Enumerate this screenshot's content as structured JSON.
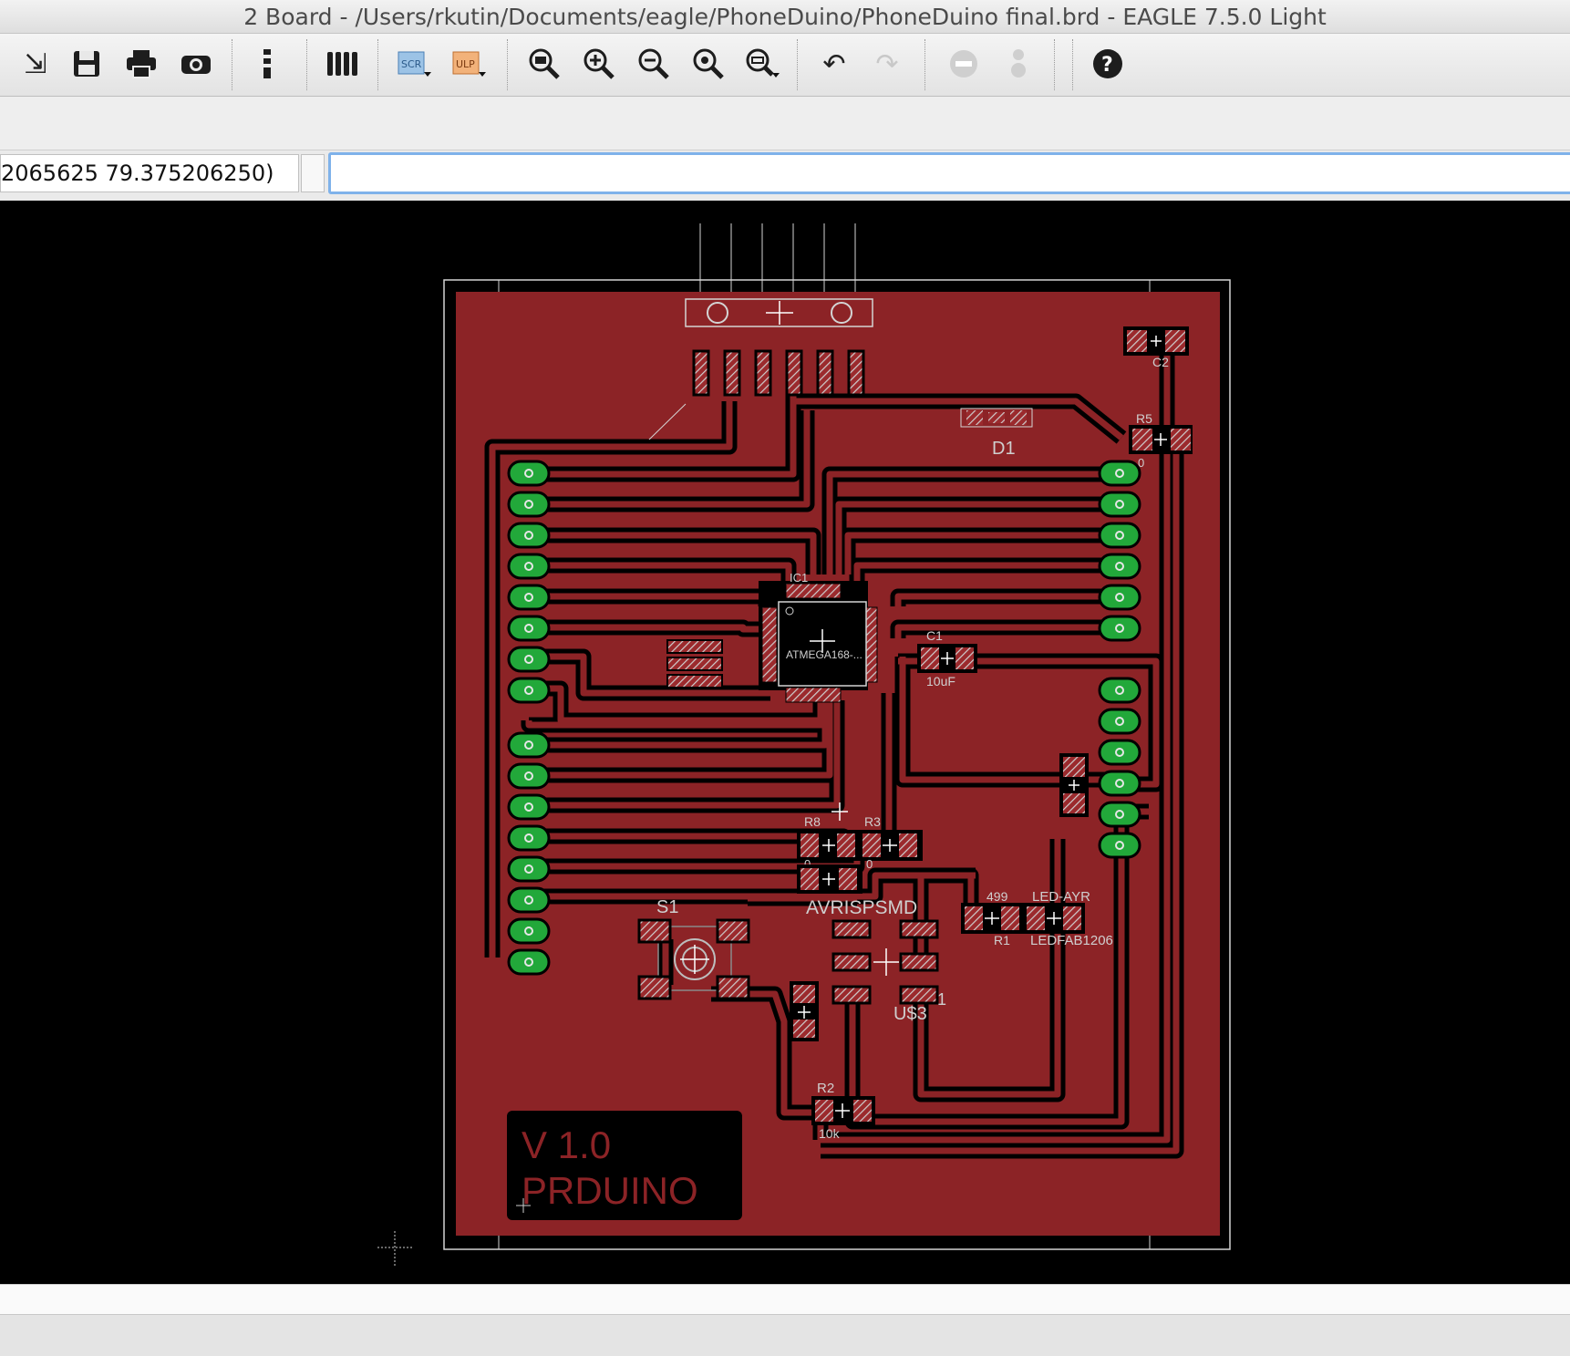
{
  "window": {
    "title": "2 Board - /Users/rkutin/Documents/eagle/PhoneDuino/PhoneDuino final.brd - EAGLE 7.5.0 Light"
  },
  "toolbar": {
    "buttons": [
      {
        "id": "open",
        "glyph": "⇲"
      },
      {
        "id": "save",
        "glyph": "💾"
      },
      {
        "id": "print",
        "glyph": "⎙"
      },
      {
        "id": "cam",
        "glyph": "◙"
      },
      {
        "id": "board",
        "glyph": "⋮"
      },
      {
        "id": "layers",
        "glyph": "▥"
      },
      {
        "id": "script",
        "label": "SCR"
      },
      {
        "id": "ulp",
        "label": "ULP"
      },
      {
        "id": "zoom-fit",
        "glyph": "⊡"
      },
      {
        "id": "zoom-in",
        "glyph": "⊕"
      },
      {
        "id": "zoom-out",
        "glyph": "⊖"
      },
      {
        "id": "zoom-select",
        "glyph": "⊙"
      },
      {
        "id": "zoom-redraw",
        "glyph": "⊜"
      },
      {
        "id": "undo",
        "glyph": "↶"
      },
      {
        "id": "redo",
        "glyph": "↷"
      },
      {
        "id": "stop",
        "glyph": "⊖"
      },
      {
        "id": "go",
        "glyph": "●"
      },
      {
        "id": "help",
        "glyph": "?"
      }
    ]
  },
  "command_bar": {
    "coordinates": "2065625 79.375206250)",
    "command_value": ""
  },
  "board": {
    "silkscreen_text": [
      "V 1.0",
      "PRDUINO"
    ],
    "part_labels": {
      "c2": "C2",
      "r5": "R5",
      "r5_value": "0",
      "d1": "D1",
      "ic1": "IC1",
      "ic1_value": "ATMEGA168-...",
      "c1": "C1",
      "c1_value": "10uF",
      "r8": "R8",
      "r8_value": "0",
      "r3": "R3",
      "r3_value": "0",
      "avrisp": "AVRISPSMD",
      "s1": "S1",
      "r1_value": "499",
      "r1": "R1",
      "led": "LED-AYR",
      "led_value": "LEDFAB1206",
      "u3": "U$3",
      "u3_pin": "1",
      "r2": "R2",
      "r2_value": "10k"
    },
    "colors": {
      "background": "#000000",
      "copper_fill": "#8c2326",
      "copper_trace": "#8c2326",
      "gap": "#000000",
      "pad": "#9b2a2d",
      "pad_hatch": "#c7c7c7",
      "via_pad": "#22a83a",
      "outline": "#d4d4d4",
      "label": "#cfcfcf"
    }
  }
}
